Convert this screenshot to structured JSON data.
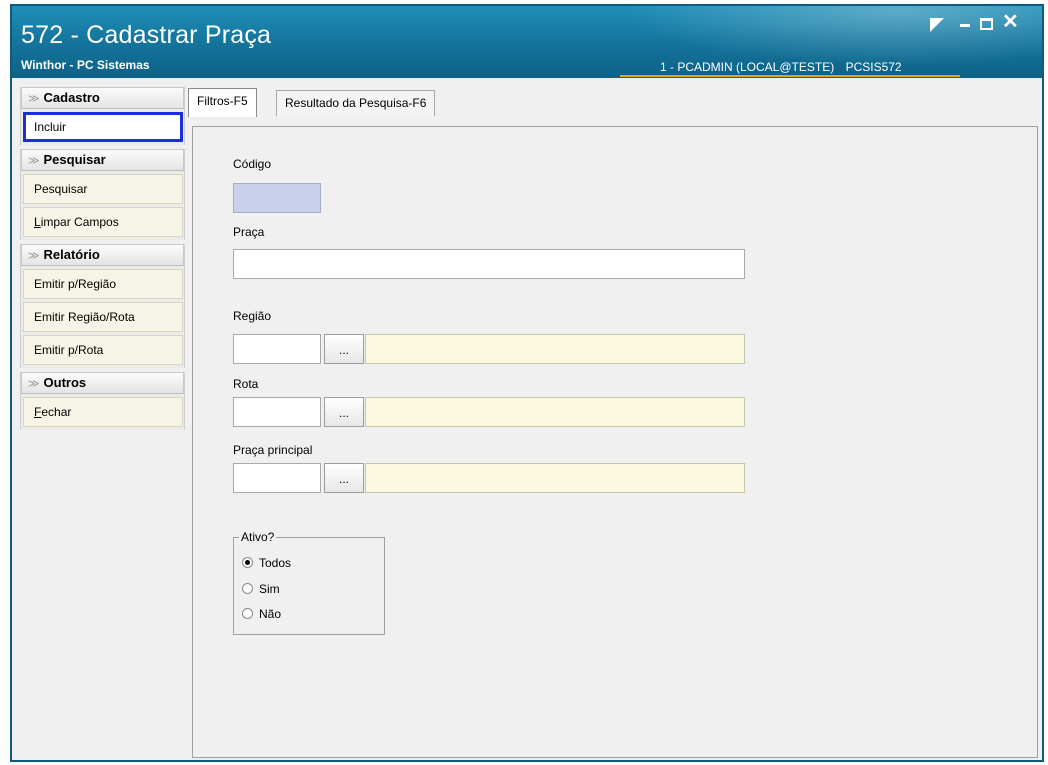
{
  "window": {
    "title": "572 - Cadastrar Praça",
    "subtitle": "Winthor - PC Sistemas",
    "user": "1 - PCADMIN (LOCAL@TESTE)",
    "routine": "PCSIS572",
    "close_glyph": "✕"
  },
  "sidebar": {
    "sections": [
      {
        "title": "Cadastro",
        "items": [
          "Incluir"
        ]
      },
      {
        "title": "Pesquisar",
        "items": [
          "Pesquisar",
          "Limpar Campos"
        ]
      },
      {
        "title": "Relatório",
        "items": [
          "Emitir p/Região",
          "Emitir Região/Rota",
          "Emitir p/Rota"
        ]
      },
      {
        "title": "Outros",
        "items": [
          "Fechar"
        ]
      }
    ],
    "chevron": "≫",
    "selected_item": "Incluir",
    "limpar_first": "L",
    "limpar_rest": "impar Campos",
    "fechar_first": "F",
    "fechar_rest": "echar"
  },
  "tabs": [
    {
      "label": "Filtros-F5",
      "active": true
    },
    {
      "label": "Resultado da Pesquisa-F6",
      "active": false
    }
  ],
  "form": {
    "codigo": {
      "label": "Código",
      "value": ""
    },
    "praca": {
      "label": "Praça",
      "value": ""
    },
    "regiao": {
      "label": "Região",
      "code": "",
      "desc": ""
    },
    "rota": {
      "label": "Rota",
      "code": "",
      "desc": ""
    },
    "praca_principal": {
      "label": "Praça principal",
      "code": "",
      "desc": ""
    },
    "lookup_label": "...",
    "ativo": {
      "label": "Ativo?",
      "options": [
        "Todos",
        "Sim",
        "Não"
      ],
      "selected": "Todos"
    }
  },
  "colors": {
    "title_bar": "#15779f",
    "selected_border": "#1b2fd6",
    "readonly_field": "#c8d0ec",
    "description_field": "#fbfae0"
  }
}
